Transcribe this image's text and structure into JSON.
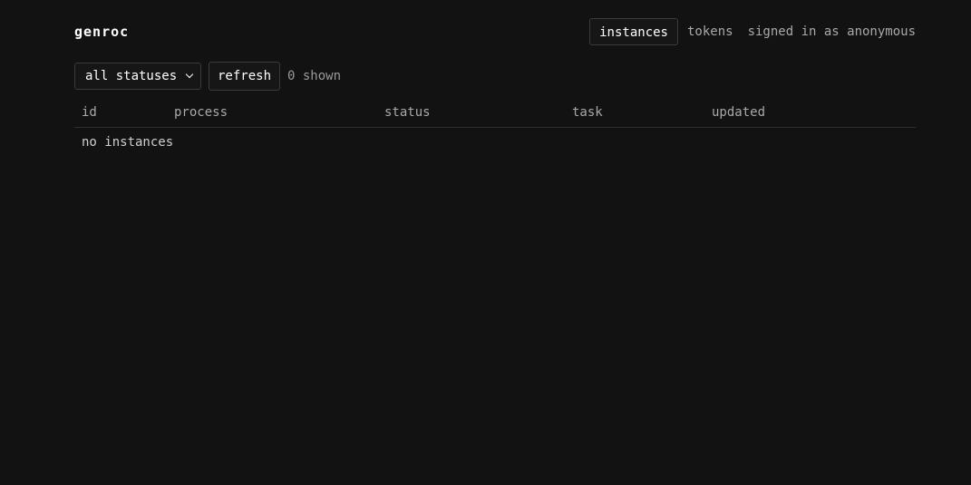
{
  "header": {
    "brand": "genroc",
    "nav": [
      {
        "label": "instances",
        "active": true
      },
      {
        "label": "tokens",
        "active": false
      }
    ],
    "signed_in": "signed in as anonymous"
  },
  "toolbar": {
    "status_filter": "all statuses",
    "refresh_label": "refresh",
    "count_text": "0 shown"
  },
  "table": {
    "columns": [
      "id",
      "process",
      "status",
      "task",
      "updated"
    ],
    "empty_text": "no instances"
  },
  "colors": {
    "background": "#121212",
    "border": "#3a3a3a",
    "text": "#cfcfcf",
    "muted": "#a9a9a9"
  }
}
